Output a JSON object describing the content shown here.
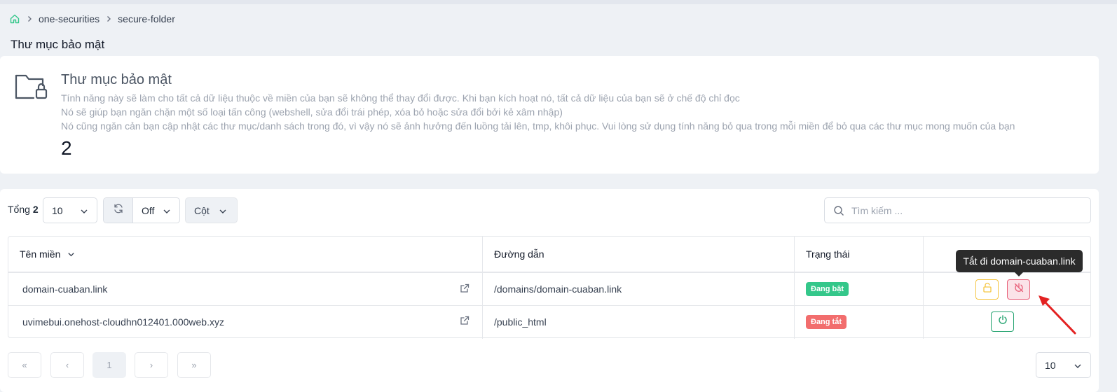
{
  "breadcrumb": {
    "items": [
      "one-securities",
      "secure-folder"
    ]
  },
  "page_title": "Thư mục bảo mật",
  "info": {
    "title": "Thư mục bảo mật",
    "lines": [
      "Tính năng này sẽ làm cho tất cả dữ liệu thuộc về miền của bạn sẽ không thể thay đổi được. Khi bạn kích hoạt nó, tất cả dữ liệu của bạn sẽ ở chế độ chỉ đọc",
      "Nó sẽ giúp bạn ngăn chặn một số loại tấn công (webshell, sửa đổi trái phép, xóa bỏ hoặc sửa đổi bởi kẻ xâm nhập)",
      "Nó cũng ngăn cản bạn cập nhật các thư mục/danh sách trong đó, vì vậy nó sẽ ảnh hưởng đến luồng tải lên, tmp, khôi phục. Vui lòng sử dụng tính năng bỏ qua trong mỗi miền để bỏ qua các thư mục mong muốn của bạn"
    ],
    "count": "2"
  },
  "toolbar": {
    "total_label": "Tổng",
    "total_value": "2",
    "page_size": "10",
    "refresh_value": "Off",
    "columns_label": "Cột",
    "search_placeholder": "Tìm kiếm ..."
  },
  "table": {
    "headers": {
      "domain": "Tên miền",
      "path": "Đường dẫn",
      "status": "Trạng thái"
    },
    "rows": [
      {
        "domain": "domain-cuaban.link",
        "path": "/domains/domain-cuaban.link",
        "status": "Đang bật"
      },
      {
        "domain": "uvimebui.onehost-cloudhn012401.000web.xyz",
        "path": "/public_html",
        "status": "Đang tắt"
      }
    ]
  },
  "tooltip": "Tắt đi domain-cuaban.link",
  "pagination": {
    "first": "«",
    "prev": "‹",
    "current": "1",
    "next": "›",
    "last": "»",
    "page_size": "10"
  },
  "colors": {
    "on": "#34c78a",
    "off": "#f26d6d",
    "accent_green": "#24a370",
    "warning": "#f5c644",
    "danger": "#e8617a"
  }
}
